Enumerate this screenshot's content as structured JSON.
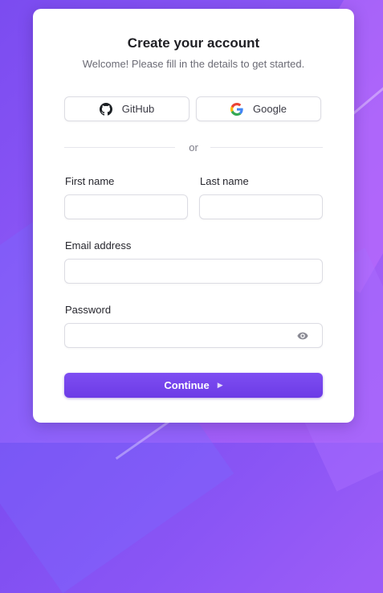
{
  "form": {
    "title": "Create your account",
    "subtitle": "Welcome! Please fill in the details to get started.",
    "social": {
      "github_label": "GitHub",
      "github_icon": "github-icon",
      "google_label": "Google",
      "google_icon": "google-icon"
    },
    "divider_text": "or",
    "fields": {
      "first_name": {
        "label": "First name",
        "value": "",
        "placeholder": ""
      },
      "last_name": {
        "label": "Last name",
        "value": "",
        "placeholder": ""
      },
      "email": {
        "label": "Email address",
        "value": "",
        "placeholder": ""
      },
      "password": {
        "label": "Password",
        "value": "",
        "placeholder": "",
        "toggle_icon": "eye-icon"
      }
    },
    "continue_label": "Continue",
    "continue_icon": "caret-right-icon"
  },
  "colors": {
    "accent": "#6c47ff",
    "background_gradient_start": "#7b4cf0",
    "background_gradient_end": "#a65ff6",
    "card": "#ffffff"
  }
}
